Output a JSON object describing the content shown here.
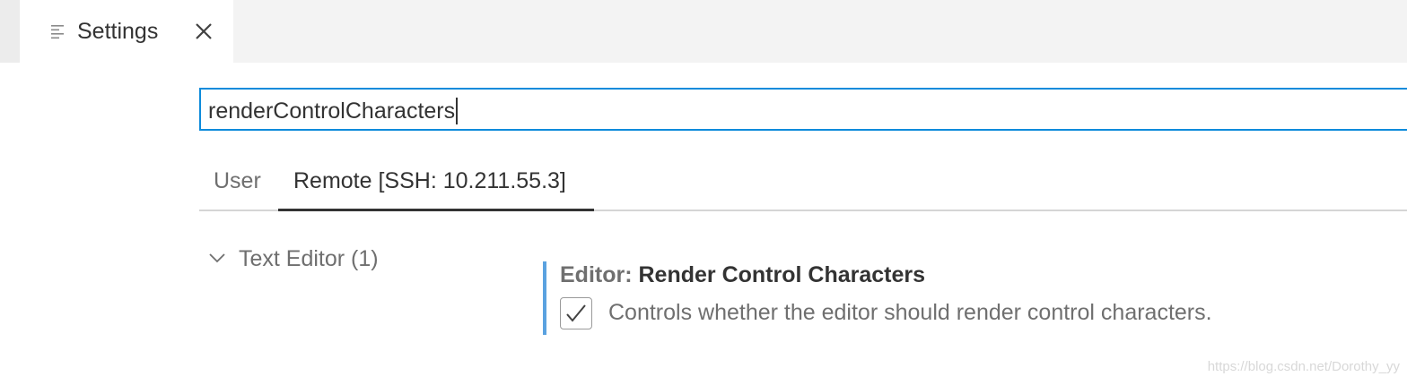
{
  "tab": {
    "label": "Settings",
    "icon": "settings-editor-icon",
    "close_icon": "close-icon"
  },
  "search": {
    "value": "renderControlCharacters"
  },
  "scope_tabs": [
    {
      "label": "User",
      "active": false
    },
    {
      "label": "Remote [SSH: 10.211.55.3]",
      "active": true
    }
  ],
  "toc": {
    "item_label": "Text Editor (1)",
    "expanded": true
  },
  "setting": {
    "category": "Editor:",
    "name": "Render Control Characters",
    "checked": true,
    "description": "Controls whether the editor should render control characters."
  },
  "watermark": "https://blog.csdn.net/Dorothy_yy",
  "colors": {
    "focus_border": "#0e8bdb",
    "modified_indicator": "#5aa2e0",
    "tabbar_bg": "#f3f3f3"
  }
}
